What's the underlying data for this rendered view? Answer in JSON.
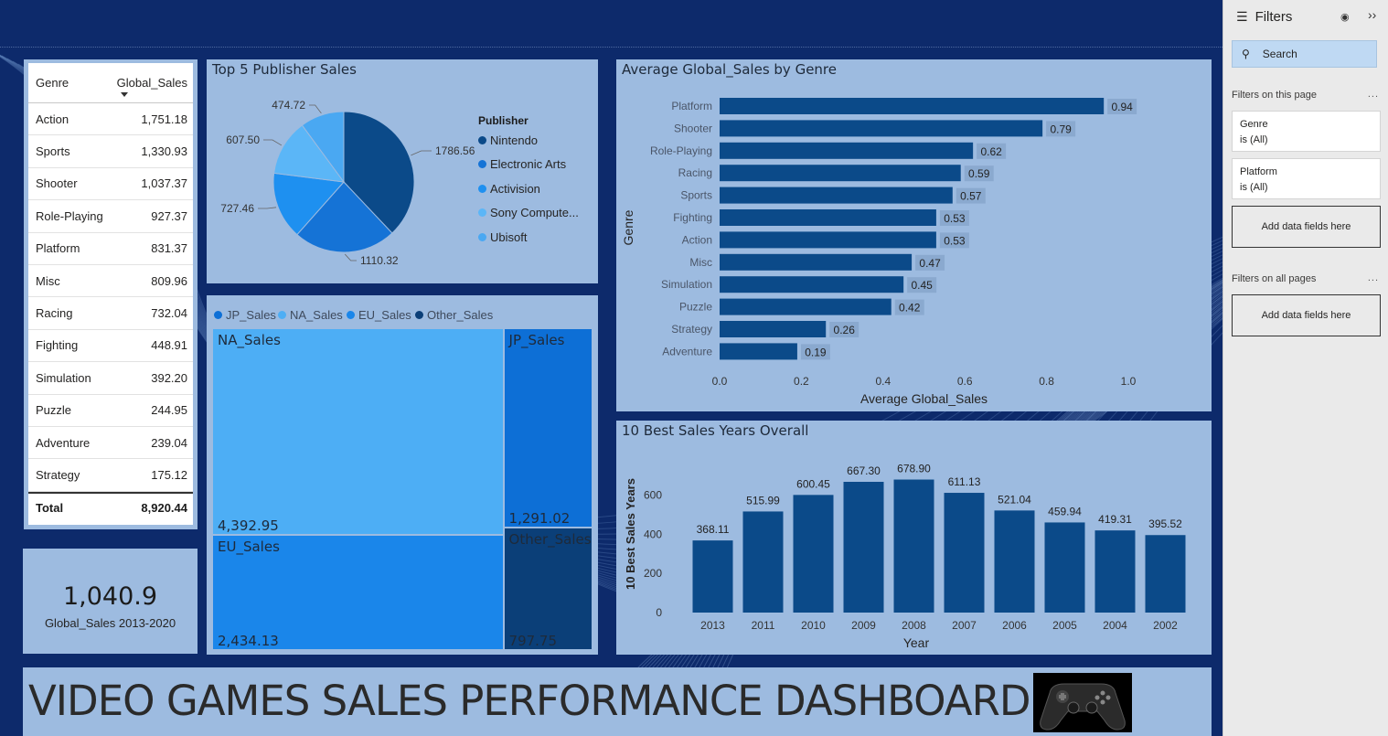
{
  "banner": {
    "title": "VIDEO GAMES SALES PERFORMANCE DASHBOARD",
    "image": "game-controller-image"
  },
  "genre_table": {
    "headers": [
      "Genre",
      "Global_Sales"
    ],
    "rows": [
      [
        "Action",
        "1,751.18"
      ],
      [
        "Sports",
        "1,330.93"
      ],
      [
        "Shooter",
        "1,037.37"
      ],
      [
        "Role-Playing",
        "927.37"
      ],
      [
        "Platform",
        "831.37"
      ],
      [
        "Misc",
        "809.96"
      ],
      [
        "Racing",
        "732.04"
      ],
      [
        "Fighting",
        "448.91"
      ],
      [
        "Simulation",
        "392.20"
      ],
      [
        "Puzzle",
        "244.95"
      ],
      [
        "Adventure",
        "239.04"
      ],
      [
        "Strategy",
        "175.12"
      ]
    ],
    "total_label": "Total",
    "total_value": "8,920.44"
  },
  "kpi": {
    "value": "1,040.9",
    "label": "Global_Sales 2013-2020"
  },
  "chart_data": [
    {
      "type": "pie",
      "title": "Top 5 Publisher Sales",
      "legend_title": "Publisher",
      "labels": [
        "Nintendo",
        "Electronic Arts",
        "Activision",
        "Sony Compute...",
        "Ubisoft"
      ],
      "values": [
        1786.56,
        1110.32,
        727.46,
        607.5,
        474.72
      ],
      "value_labels": [
        "1786.56",
        "1110.32",
        "727.46",
        "607.50",
        "474.72"
      ],
      "colors": [
        "#0b4a89",
        "#1573d6",
        "#1e90f0",
        "#5bb6f7",
        "#4aa8f2"
      ]
    },
    {
      "type": "heatmap",
      "legend": [
        "JP_Sales",
        "NA_Sales",
        "EU_Sales",
        "Other_Sales"
      ],
      "legend_colors": [
        "#0d6fd6",
        "#4daef5",
        "#1a86ea",
        "#0b3f78"
      ],
      "tiles": [
        {
          "name": "NA_Sales",
          "value": 4392.95,
          "label": "4,392.95",
          "color": "#4daef5"
        },
        {
          "name": "EU_Sales",
          "value": 2434.13,
          "label": "2,434.13",
          "color": "#1a86ea"
        },
        {
          "name": "JP_Sales",
          "value": 1291.02,
          "label": "1,291.02",
          "color": "#0d6fd6"
        },
        {
          "name": "Other_Sales",
          "value": 797.75,
          "label": "797.75",
          "color": "#0b3f78"
        }
      ]
    },
    {
      "type": "bar",
      "title": "Average Global_Sales by Genre",
      "orientation": "horizontal",
      "categories": [
        "Platform",
        "Shooter",
        "Role-Playing",
        "Racing",
        "Sports",
        "Fighting",
        "Action",
        "Misc",
        "Simulation",
        "Puzzle",
        "Strategy",
        "Adventure"
      ],
      "values": [
        0.94,
        0.79,
        0.62,
        0.59,
        0.57,
        0.53,
        0.53,
        0.47,
        0.45,
        0.42,
        0.26,
        0.19
      ],
      "xlabel": "Average Global_Sales",
      "ylabel": "Genre",
      "xlim": [
        0,
        1.0
      ],
      "xticks": [
        "0.0",
        "0.2",
        "0.4",
        "0.6",
        "0.8",
        "1.0"
      ],
      "color": "#0b4a89"
    },
    {
      "type": "bar",
      "title": "10 Best Sales Years Overall",
      "categories": [
        "2013",
        "2011",
        "2010",
        "2009",
        "2008",
        "2007",
        "2006",
        "2005",
        "2004",
        "2002"
      ],
      "values": [
        368.11,
        515.99,
        600.45,
        667.3,
        678.9,
        611.13,
        521.04,
        459.94,
        419.31,
        395.52
      ],
      "xlabel": "Year",
      "ylabel": "10 Best Sales Years",
      "ylim": [
        0,
        700
      ],
      "yticks": [
        "0",
        "200",
        "400",
        "600"
      ],
      "color": "#0b4a89"
    }
  ],
  "filters": {
    "title": "Filters",
    "search_placeholder": "Search",
    "this_page_label": "Filters on this page",
    "all_pages_label": "Filters on all pages",
    "cards": [
      {
        "field": "Genre",
        "state": "is (All)"
      },
      {
        "field": "Platform",
        "state": "is (All)"
      }
    ],
    "add_label": "Add data fields here",
    "more": "..."
  }
}
